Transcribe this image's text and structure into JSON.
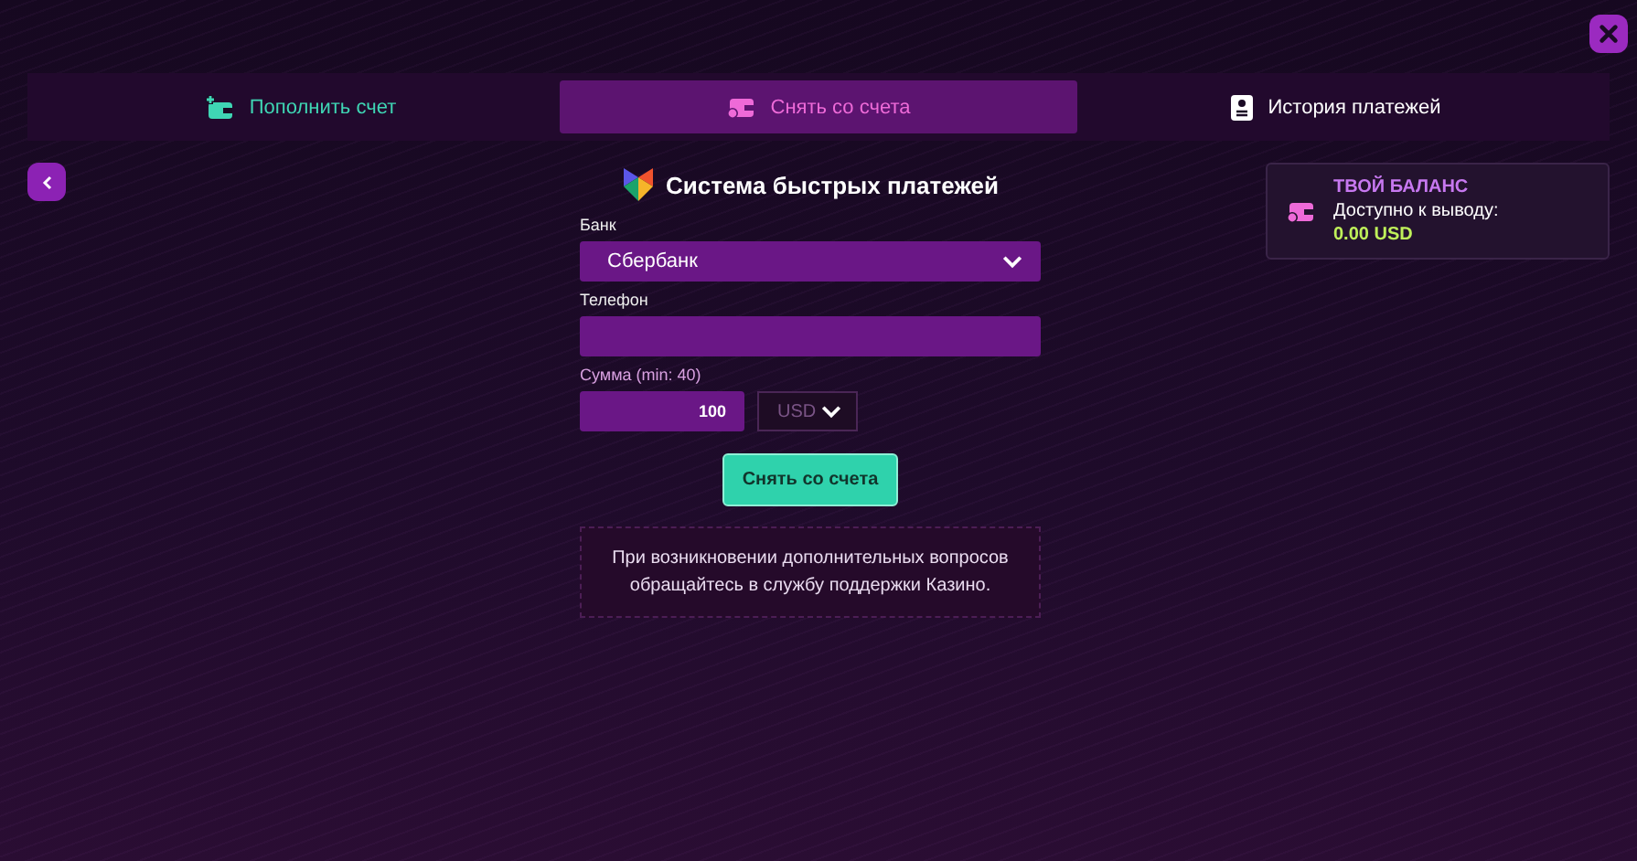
{
  "tabs": [
    {
      "label": "Пополнить счет",
      "kind": "deposit",
      "selected": false,
      "color": "#3fd6b4"
    },
    {
      "label": "Снять со счета",
      "kind": "withdraw",
      "selected": true,
      "color": "#ee6ad8"
    },
    {
      "label": "История платежей",
      "kind": "history",
      "selected": false,
      "color": "#ffffff"
    }
  ],
  "form": {
    "title": "Система быстрых платежей",
    "bank_label": "Банк",
    "bank_value": "Сбербанк",
    "phone_label": "Телефон",
    "amount_label": "Сумма (min: 40)",
    "amount_value": "100",
    "currency": "USD",
    "currency_disabled": true,
    "submit": "Снять со счета",
    "note": "При возникновении дополнительных вопросов обращайтесь в службу поддержки Казино."
  },
  "balance": {
    "title": "ТВОЙ БАЛАНС",
    "label": "Доступно к выводу:",
    "amount": "0.00 USD"
  }
}
